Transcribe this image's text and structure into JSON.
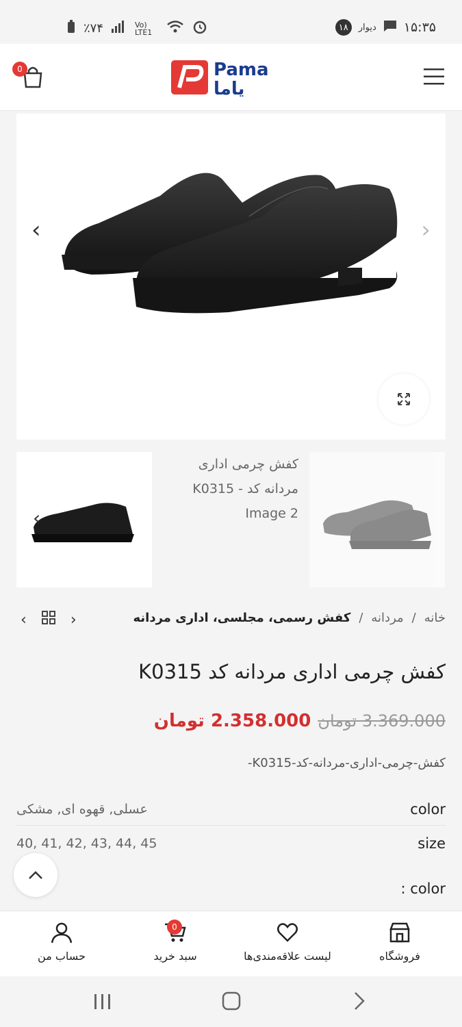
{
  "status_bar": {
    "battery": "٪۷۴",
    "network": "Vo) LTE1",
    "notification_app": "دیوار",
    "notification_count": "۱۸",
    "time": "۱۵:۳۵"
  },
  "header": {
    "cart_count": "0",
    "logo_text_latin": "Pama",
    "logo_text_fa": "پاما"
  },
  "gallery": {
    "thumb2_alt": "کفش چرمی اداری مردانه کد - K0315 Image 2"
  },
  "breadcrumbs": {
    "items": [
      "خانه",
      "مردانه",
      "کفش رسمی، مجلسی، اداری مردانه"
    ],
    "separator": "/"
  },
  "product": {
    "title": "کفش چرمی اداری مردانه کد K0315",
    "old_price": "3.369.000 تومان",
    "new_price": "2.358.000 تومان",
    "slug": "کفش-چرمی-اداری-مردانه-کد-K0315-",
    "attributes": {
      "color_label": "color",
      "color_value": "عسلی, قهوه ای, مشکی",
      "size_label": "size",
      "size_value": "40, 41, 42, 43, 44, 45"
    },
    "color_selector_label": ": color"
  },
  "bottom_nav": {
    "shop": "فروشگاه",
    "wishlist": "لیست علاقه‌مندی‌ها",
    "cart": "سبد خرید",
    "cart_count": "0",
    "account": "حساب من"
  },
  "colors": {
    "accent_red": "#d32f2f",
    "logo_blue": "#1a3c8f"
  }
}
